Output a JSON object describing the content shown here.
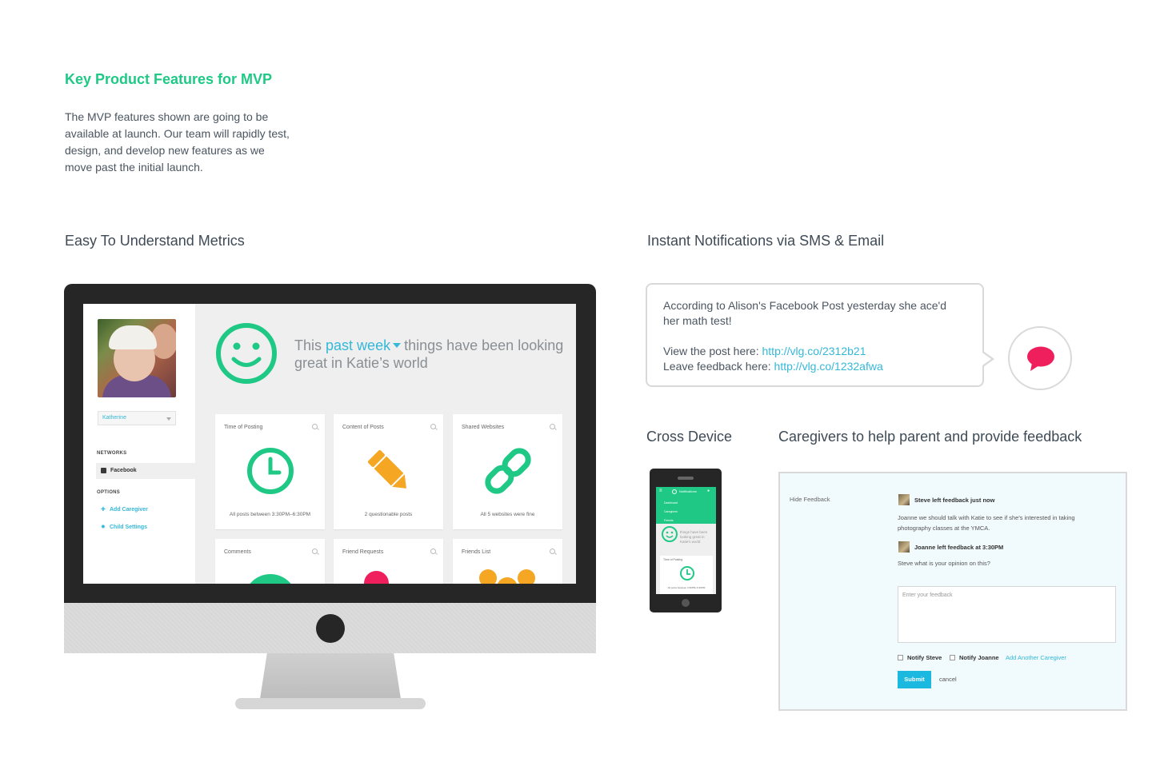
{
  "header": {
    "title": "Key Product Features for MVP",
    "intro": "The MVP features shown are going to be available at launch. Our team will rapidly test, design, and develop new features as we move past the initial launch."
  },
  "sections": {
    "metrics": "Easy To Understand Metrics",
    "notifications": "Instant Notifications via SMS & Email",
    "cross_device": "Cross Device",
    "caregivers": "Caregivers to help parent and provide feedback"
  },
  "dashboard": {
    "child_select": "Katherine",
    "networks_label": "NETWORKS",
    "network_item": "Facebook",
    "options_label": "OPTIONS",
    "add_caregiver": "Add Caregiver",
    "child_settings": "Child Settings",
    "headline_pre": "This",
    "headline_range": "past week",
    "headline_post": "things have been looking great in Katie’s world",
    "cards": [
      {
        "title": "Time of Posting",
        "footer": "All posts between 3:30PM–6:30PM",
        "icon": "clock-icon"
      },
      {
        "title": "Content of Posts",
        "footer": "2 questionable posts",
        "icon": "pencil-icon"
      },
      {
        "title": "Shared Websites",
        "footer": "All 5 websites were fine",
        "icon": "link-icon"
      },
      {
        "title": "Comments",
        "icon": "smiley-icon"
      },
      {
        "title": "Friend Requests",
        "icon": "dot-icon"
      },
      {
        "title": "Friends List",
        "icon": "people-icon"
      }
    ],
    "colors": {
      "green": "#1fc985",
      "blue": "#34b8d8",
      "orange": "#f5a623",
      "red": "#ef1f5d"
    }
  },
  "notification": {
    "line1": "According to Alison's Facebook Post yesterday she ace'd",
    "line2": "her math test!",
    "view_label": "View the post here:",
    "view_link": "http://vlg.co/2312b21",
    "leave_label": "Leave feedback here:",
    "leave_link": "http://vlg.co/1232afwa",
    "icon": "chat-bubble-icon",
    "icon_color": "#ef1f5d"
  },
  "phone": {
    "menu_items": [
      "Dashboard",
      "Caregivers",
      "Friends"
    ],
    "top_label": "Notifications",
    "snippet": "things have been looking great in Katie's world",
    "card_title": "Time of Posting",
    "card_footer": "All posts between 3:30PM–6:30PM"
  },
  "caregivers": {
    "hide_feedback": "Hide Feedback",
    "f1_title": "Steve left feedback just now",
    "f1_body": "Joanne we should talk with Katie to see if she's interested in taking photography classes at the YMCA.",
    "f2_title": "Joanne left feedback at 3:30PM",
    "f2_body": "Steve what is your opinion on this?",
    "input_placeholder": "Enter your feedback",
    "notify_steve": "Notify Steve",
    "notify_joanne": "Notify Joanne",
    "add_another": "Add Another Caregiver",
    "submit": "Submit",
    "cancel": "cancel"
  }
}
